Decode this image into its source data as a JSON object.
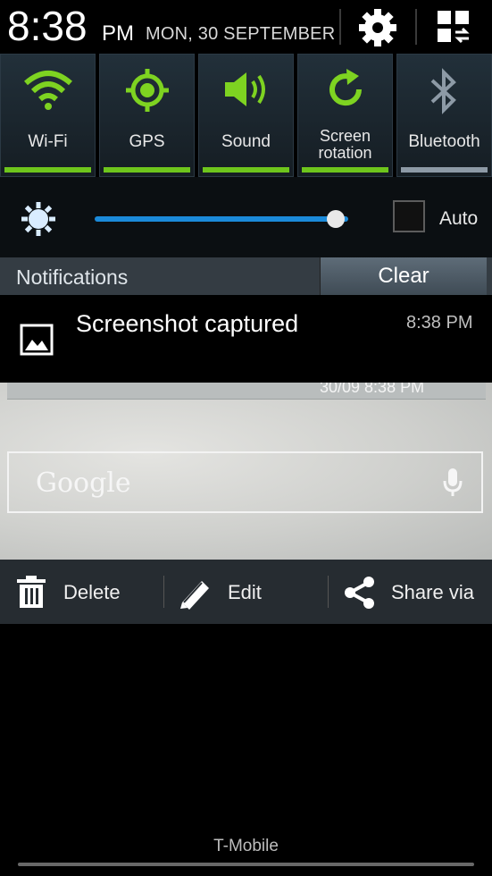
{
  "status_bar": {
    "time": "8:38",
    "ampm": "PM",
    "date": "MON, 30 SEPTEMBER"
  },
  "toggles": [
    {
      "label": "Wi-Fi",
      "icon": "wifi-icon",
      "state": "on"
    },
    {
      "label": "GPS",
      "icon": "gps-icon",
      "state": "on"
    },
    {
      "label": "Sound",
      "icon": "sound-icon",
      "state": "on"
    },
    {
      "label_line1": "Screen",
      "label_line2": "rotation",
      "icon": "rotation-icon",
      "state": "on"
    },
    {
      "label": "Bluetooth",
      "icon": "bluetooth-icon",
      "state": "off"
    }
  ],
  "brightness": {
    "level": 0.95,
    "auto_label": "Auto",
    "auto_checked": false
  },
  "notifications": {
    "title": "Notifications",
    "clear_label": "Clear",
    "items": [
      {
        "title": "Screenshot captured",
        "time": "8:38 PM",
        "icon": "image-icon"
      }
    ]
  },
  "preview": {
    "strip_text": "30/09 8:38 PM",
    "search_brand": "Google"
  },
  "actions": [
    {
      "label": "Delete",
      "icon": "trash-icon"
    },
    {
      "label": "Edit",
      "icon": "pencil-icon"
    },
    {
      "label": "Share via",
      "icon": "share-icon"
    }
  ],
  "carrier": "T-Mobile",
  "colors": {
    "toggle_on": "#6ec51c",
    "toggle_off": "#8d9aa6",
    "slider": "#1b8ad9"
  }
}
